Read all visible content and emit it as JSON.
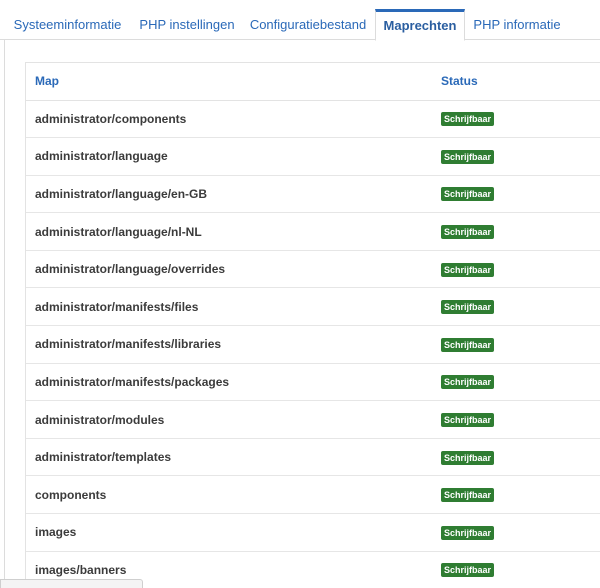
{
  "tabs": [
    {
      "label": "Systeeminformatie",
      "active": false
    },
    {
      "label": "PHP instellingen",
      "active": false
    },
    {
      "label": "Configuratiebestand",
      "active": false
    },
    {
      "label": "Maprechten",
      "active": true
    },
    {
      "label": "PHP informatie",
      "active": false
    }
  ],
  "table": {
    "headers": {
      "map": "Map",
      "status": "Status"
    },
    "rows": [
      {
        "map": "administrator/components",
        "status": "Schrijfbaar"
      },
      {
        "map": "administrator/language",
        "status": "Schrijfbaar"
      },
      {
        "map": "administrator/language/en-GB",
        "status": "Schrijfbaar"
      },
      {
        "map": "administrator/language/nl-NL",
        "status": "Schrijfbaar"
      },
      {
        "map": "administrator/language/overrides",
        "status": "Schrijfbaar"
      },
      {
        "map": "administrator/manifests/files",
        "status": "Schrijfbaar"
      },
      {
        "map": "administrator/manifests/libraries",
        "status": "Schrijfbaar"
      },
      {
        "map": "administrator/manifests/packages",
        "status": "Schrijfbaar"
      },
      {
        "map": "administrator/modules",
        "status": "Schrijfbaar"
      },
      {
        "map": "administrator/templates",
        "status": "Schrijfbaar"
      },
      {
        "map": "components",
        "status": "Schrijfbaar"
      },
      {
        "map": "images",
        "status": "Schrijfbaar"
      },
      {
        "map": "images/banners",
        "status": "Schrijfbaar"
      }
    ]
  },
  "colors": {
    "accent": "#2a69b8",
    "badge_green": "#2f7d32"
  }
}
